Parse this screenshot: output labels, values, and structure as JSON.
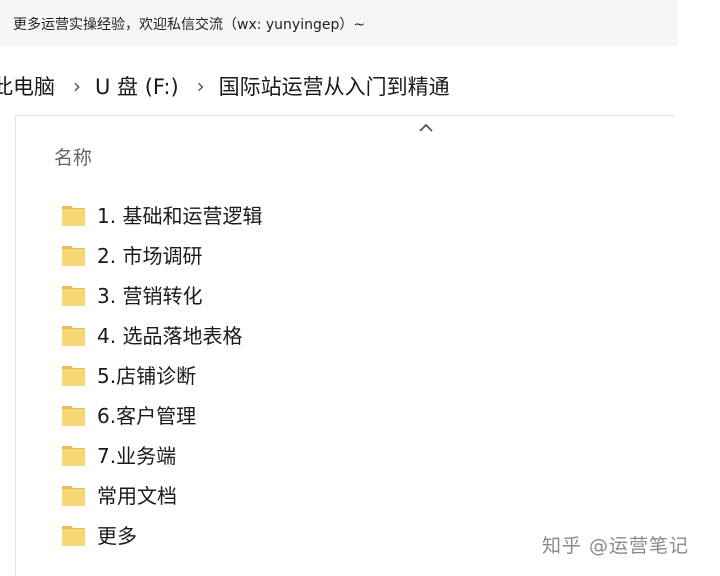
{
  "top_note": "更多运营实操经验，欢迎私信交流（wx: yunyingep）~",
  "breadcrumb": {
    "items": [
      "此电脑",
      "U 盘 (F:)",
      "国际站运营从入门到精通"
    ],
    "separator": "›"
  },
  "explorer": {
    "column_header": "名称",
    "sort_indicator": "chevron-up-icon",
    "folders": [
      {
        "name": "1. 基础和运营逻辑",
        "icon": "folder-icon"
      },
      {
        "name": "2. 市场调研",
        "icon": "folder-icon"
      },
      {
        "name": "3. 营销转化",
        "icon": "folder-icon"
      },
      {
        "name": "4. 选品落地表格",
        "icon": "folder-icon"
      },
      {
        "name": "5.店铺诊断",
        "icon": "folder-icon"
      },
      {
        "name": "6.客户管理",
        "icon": "folder-icon"
      },
      {
        "name": "7.业务端",
        "icon": "folder-icon"
      },
      {
        "name": "常用文档",
        "icon": "folder-icon"
      },
      {
        "name": "更多",
        "icon": "folder-icon"
      }
    ]
  },
  "watermark": "知乎 @运营笔记",
  "colors": {
    "folder_fill": "#f8d775",
    "folder_tab": "#e8bf4f",
    "text": "#1a1a1a",
    "header_text": "#666666",
    "top_bar_bg": "#f6f6f6"
  }
}
